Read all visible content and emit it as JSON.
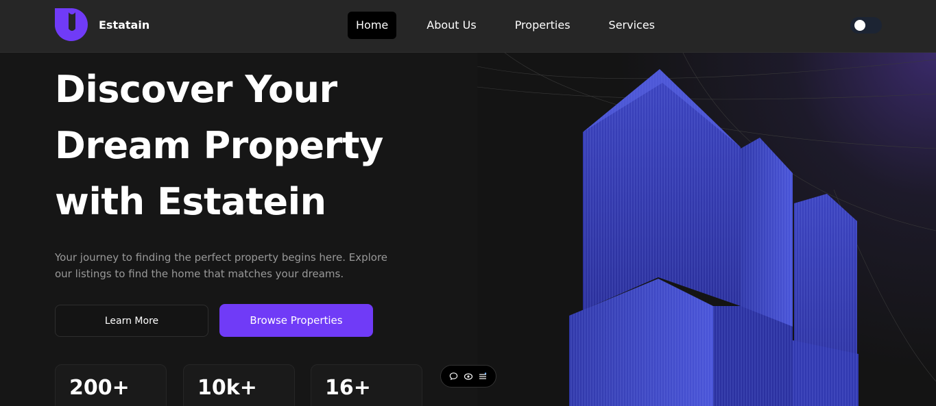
{
  "header": {
    "brand": "Estatain",
    "nav": [
      {
        "label": "Home",
        "active": true
      },
      {
        "label": "About Us",
        "active": false
      },
      {
        "label": "Properties",
        "active": false
      },
      {
        "label": "Services",
        "active": false
      }
    ],
    "theme_toggle": "theme-toggle"
  },
  "hero": {
    "title": "Discover Your Dream Property with Estatein",
    "subtitle": "Your journey to finding the perfect property begins here. Explore our listings to find the home that matches your dreams.",
    "learn_more": "Learn More",
    "browse": "Browse Properties"
  },
  "stats": [
    {
      "value": "200+"
    },
    {
      "value": "10k+"
    },
    {
      "value": "16+"
    }
  ],
  "floating_toolbar": {
    "icons": [
      "comment-icon",
      "eye-icon",
      "menu-icon"
    ]
  },
  "colors": {
    "accent": "#703bf7",
    "header_bg": "#262626",
    "page_bg": "#141414"
  }
}
